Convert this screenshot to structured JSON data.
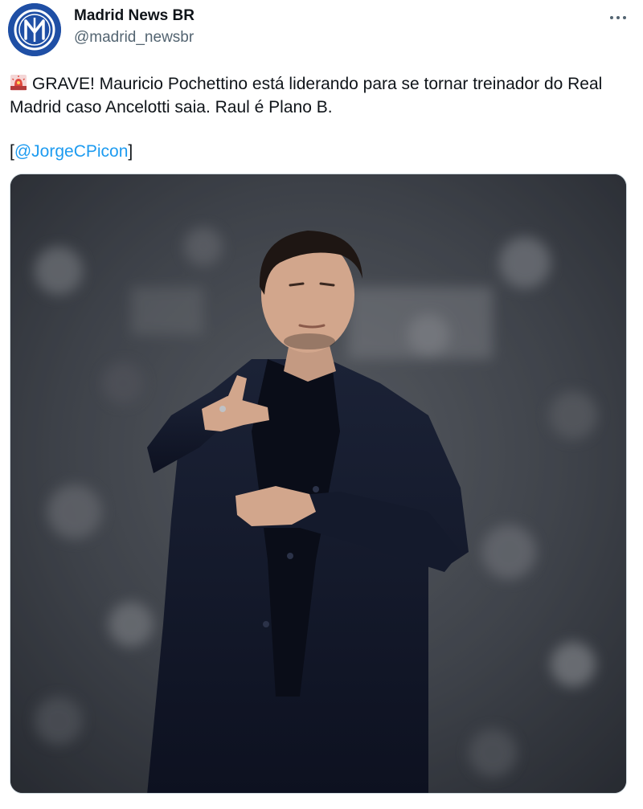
{
  "author": {
    "display_name": "Madrid News BR",
    "handle": "@madrid_newsbr",
    "avatar_icon": "madrid-news-logo-icon",
    "avatar_color": "#1f4fa5"
  },
  "more_menu": {
    "icon": "more-horizontal-icon",
    "glyph": "···"
  },
  "tweet": {
    "emoji": "siren-emoji-icon",
    "line1": "GRAVE! Mauricio Pochettino está liderando para se tornar treinador do Real Madrid caso Ancelotti saia. Raul é Plano B.",
    "source_open": "[",
    "mention": "@JorgeCPicon",
    "source_close": "]"
  },
  "media": {
    "type": "photo",
    "subject": "coach-pointing-photo"
  },
  "colors": {
    "link": "#1d9bf0",
    "text": "#0f1419",
    "secondary": "#536471",
    "border": "#cfd9de"
  }
}
